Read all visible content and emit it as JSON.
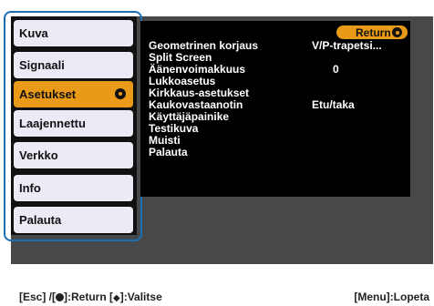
{
  "sidebar": {
    "items": [
      {
        "label": "Kuva"
      },
      {
        "label": "Signaali"
      },
      {
        "label": "Asetukset"
      },
      {
        "label": "Laajennettu"
      },
      {
        "label": "Verkko"
      },
      {
        "label": "Info"
      },
      {
        "label": "Palauta"
      }
    ]
  },
  "panel": {
    "return_label": "Return",
    "rows": [
      {
        "label": "Geometrinen korjaus",
        "value": "V/P-trapetsi..."
      },
      {
        "label": "Split Screen",
        "value": ""
      },
      {
        "label": "Äänenvoimakkuus",
        "value": "0"
      },
      {
        "label": "Lukkoasetus",
        "value": ""
      },
      {
        "label": "Kirkkaus-asetukset",
        "value": ""
      },
      {
        "label": "Kaukovastaanotin",
        "value": "Etu/taka"
      },
      {
        "label": "Käyttäjäpainike",
        "value": ""
      },
      {
        "label": "Testikuva",
        "value": ""
      },
      {
        "label": "Muisti",
        "value": ""
      },
      {
        "label": "Palauta",
        "value": ""
      }
    ]
  },
  "footer": {
    "esc": "[Esc] /[",
    "return": "]:Return  [",
    "select": "]:Valitse",
    "exit": "[Menu]:Lopeta"
  },
  "colors": {
    "accent": "#e89a18",
    "frame": "#1d6fb4",
    "screen": "#47484a",
    "panel": "#000000"
  },
  "icons": [
    "enter-icon",
    "diamond-arrows-icon"
  ]
}
